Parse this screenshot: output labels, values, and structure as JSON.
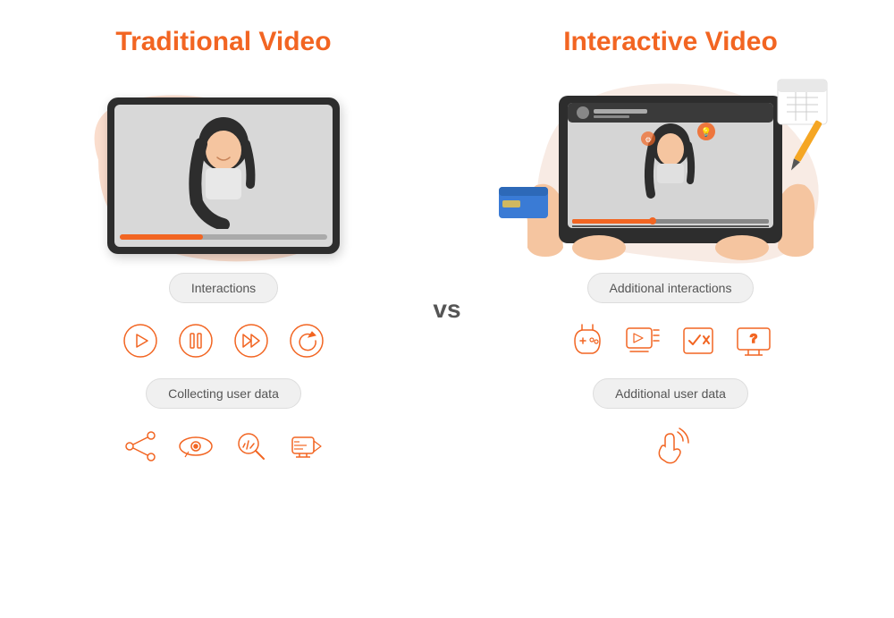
{
  "left": {
    "title": "Traditional Video",
    "interactions_label": "Interactions",
    "collecting_label": "Collecting user data",
    "icons_interactions": [
      "play-icon",
      "pause-icon",
      "fast-forward-icon",
      "replay-icon"
    ],
    "icons_data": [
      "share-icon",
      "eye-icon",
      "search-analytics-icon",
      "video-settings-icon"
    ]
  },
  "right": {
    "title": "Interactive Video",
    "interactions_label": "Additional interactions",
    "collecting_label": "Additional user data",
    "icons_interactions": [
      "gamepad-icon",
      "video-list-icon",
      "quiz-icon",
      "monitor-question-icon"
    ],
    "icons_data": [
      "touch-icon"
    ]
  },
  "vs_label": "vs",
  "colors": {
    "accent": "#f26522",
    "pill_bg": "#f0f0f0",
    "blob_left": "#f9d4c0",
    "blob_right": "#f5e2d8"
  }
}
